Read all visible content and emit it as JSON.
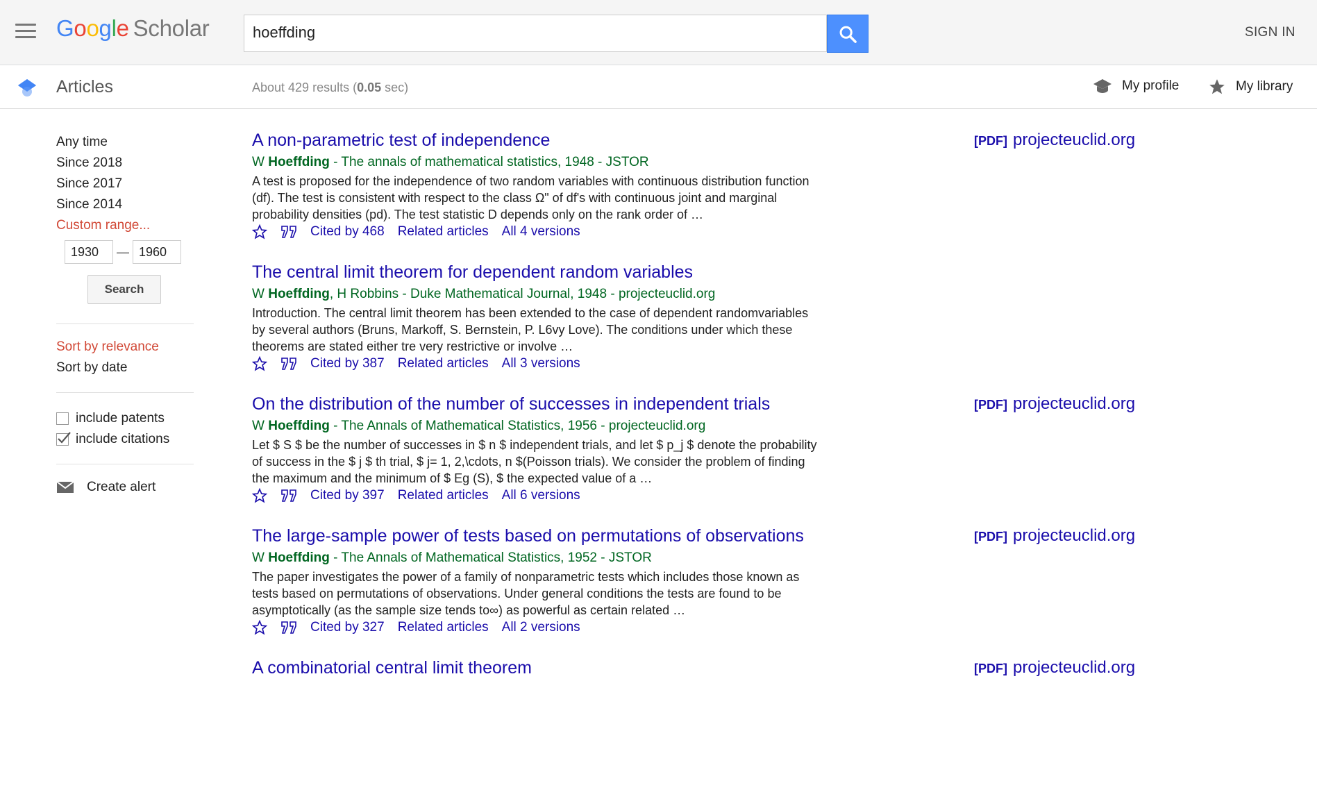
{
  "header": {
    "logo_google": "Google",
    "logo_scholar": "Scholar",
    "search_value": "hoeffding",
    "sign_in": "SIGN IN"
  },
  "subheader": {
    "section_label": "Articles",
    "stats_prefix": "About 429 results (",
    "stats_time": "0.05",
    "stats_suffix": " sec)",
    "my_profile": "My profile",
    "my_library": "My library"
  },
  "sidebar": {
    "time_filters": [
      "Any time",
      "Since 2018",
      "Since 2017",
      "Since 2014",
      "Custom range..."
    ],
    "range_from": "1930",
    "range_to": "1960",
    "range_dash": "—",
    "search_button": "Search",
    "sort_relevance": "Sort by relevance",
    "sort_date": "Sort by date",
    "include_patents": "include patents",
    "include_citations": "include citations",
    "create_alert": "Create alert"
  },
  "results": [
    {
      "title": "A non-parametric test of independence",
      "author_prefix": "W ",
      "author_bold": "Hoeffding",
      "meta_rest": " - The annals of mathematical statistics, 1948 - JSTOR",
      "snippet": "A test is proposed for the independence of two random variables with continuous distribution function (df). The test is consistent with respect to the class Ω\" of df's with continuous joint and marginal probability densities (pd). The test statistic D depends only on the rank order of …",
      "cited_by": "Cited by 468",
      "related": "Related articles",
      "versions": "All 4 versions",
      "pdf_tag": "[PDF]",
      "pdf_source": "projecteuclid.org"
    },
    {
      "title": "The central limit theorem for dependent random variables",
      "author_prefix": "W ",
      "author_bold": "Hoeffding",
      "meta_rest": ", H Robbins - Duke Mathematical Journal, 1948 - projecteuclid.org",
      "snippet": "Introduction. The central limit theorem has been extended to the case of dependent randomvariables by several authors (Bruns, Markoff, S. Bernstein, P. L6vy Love). The conditions under which these theorems are stated either tre very restrictive or involve …",
      "cited_by": "Cited by 387",
      "related": "Related articles",
      "versions": "All 3 versions",
      "pdf_tag": "",
      "pdf_source": ""
    },
    {
      "title": "On the distribution of the number of successes in independent trials",
      "author_prefix": "W ",
      "author_bold": "Hoeffding",
      "meta_rest": " - The Annals of Mathematical Statistics, 1956 - projecteuclid.org",
      "snippet": "Let $ S $ be the number of successes in $ n $ independent trials, and let $ p_j $ denote the probability of success in the $ j $ th trial, $ j= 1, 2,\\cdots, n $(Poisson trials). We consider the problem of finding the maximum and the minimum of $ Eg (S), $ the expected value of a …",
      "cited_by": "Cited by 397",
      "related": "Related articles",
      "versions": "All 6 versions",
      "pdf_tag": "[PDF]",
      "pdf_source": "projecteuclid.org"
    },
    {
      "title": "The large-sample power of tests based on permutations of observations",
      "author_prefix": "W ",
      "author_bold": "Hoeffding",
      "meta_rest": " - The Annals of Mathematical Statistics, 1952 - JSTOR",
      "snippet": "The paper investigates the power of a family of nonparametric tests which includes those known as tests based on permutations of observations. Under general conditions the tests are found to be asymptotically (as the sample size tends to∞) as powerful as certain related …",
      "cited_by": "Cited by 327",
      "related": "Related articles",
      "versions": "All 2 versions",
      "pdf_tag": "[PDF]",
      "pdf_source": "projecteuclid.org"
    },
    {
      "title": "A combinatorial central limit theorem",
      "author_prefix": "",
      "author_bold": "",
      "meta_rest": "",
      "snippet": "",
      "cited_by": "",
      "related": "",
      "versions": "",
      "pdf_tag": "[PDF]",
      "pdf_source": "projecteuclid.org"
    }
  ],
  "colors": {
    "link": "#1a0dab",
    "meta_green": "#006621",
    "active_red": "#d14836",
    "search_button_blue": "#4d90fe"
  }
}
